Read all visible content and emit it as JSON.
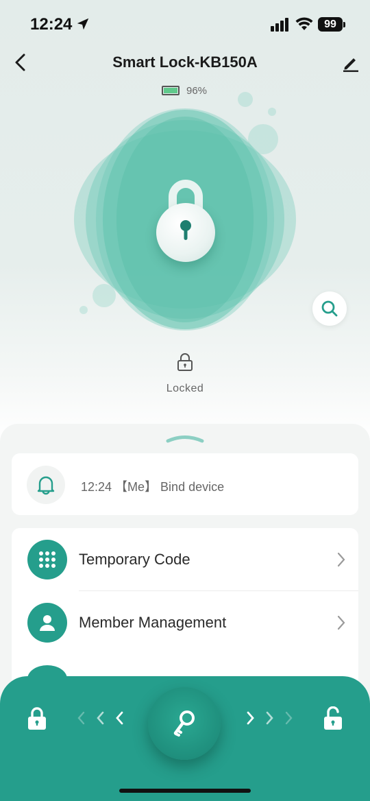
{
  "status_bar": {
    "time": "12:24",
    "battery_percent": "99"
  },
  "nav": {
    "title": "Smart Lock-KB150A"
  },
  "device": {
    "battery": "96%",
    "lock_state": "Locked"
  },
  "notification": {
    "text": "12:24 【Me】 Bind device"
  },
  "menu": {
    "items": [
      {
        "label": "Temporary Code",
        "icon": "keypad-icon"
      },
      {
        "label": "Member Management",
        "icon": "person-icon"
      }
    ]
  },
  "colors": {
    "accent": "#259e8c",
    "background": "#e3ecea",
    "battery_fill": "#5fc98b"
  }
}
